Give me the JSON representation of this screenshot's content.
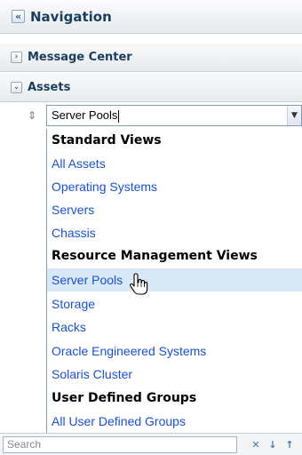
{
  "navigation": {
    "title": "Navigation",
    "collapse_icon": "double-chevron-left-icon"
  },
  "sections": [
    {
      "label": "Message Center",
      "state": "collapsed"
    },
    {
      "label": "Assets",
      "state": "expanded"
    }
  ],
  "filter": {
    "value": "Server Pools",
    "refresh_icon": "refresh-icon",
    "arrow_icon": "chevron-down-icon"
  },
  "dropdown": {
    "items": [
      {
        "type": "group",
        "label": "Standard Views"
      },
      {
        "type": "option",
        "label": "All Assets"
      },
      {
        "type": "option",
        "label": "Operating Systems"
      },
      {
        "type": "option",
        "label": "Servers"
      },
      {
        "type": "option",
        "label": "Chassis"
      },
      {
        "type": "group",
        "label": "Resource Management Views"
      },
      {
        "type": "option",
        "label": "Server Pools",
        "hovered": true
      },
      {
        "type": "option",
        "label": "Storage"
      },
      {
        "type": "option",
        "label": "Racks"
      },
      {
        "type": "option",
        "label": "Oracle Engineered Systems"
      },
      {
        "type": "option",
        "label": "Solaris Cluster"
      },
      {
        "type": "group",
        "label": "User Defined Groups"
      },
      {
        "type": "option",
        "label": "All User Defined Groups"
      }
    ]
  },
  "search": {
    "placeholder": "Search",
    "clear_icon": "clear-x-icon",
    "down_icon": "arrow-down-icon",
    "up_icon": "arrow-up-icon"
  },
  "colors": {
    "link": "#1a4fd6",
    "hover_row": "#d9e8f6",
    "header_text": "#1b3d5e"
  }
}
